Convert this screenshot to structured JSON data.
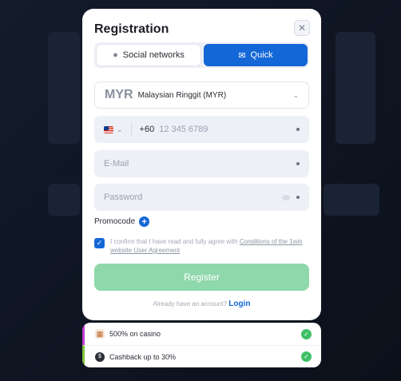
{
  "modal": {
    "title": "Registration",
    "close_icon": "close-icon"
  },
  "tabs": [
    {
      "label": "Social networks",
      "icon": "social-icon",
      "active": false
    },
    {
      "label": "Quick",
      "icon": "envelope-icon",
      "active": true
    }
  ],
  "currency": {
    "code": "MYR",
    "name": "Malaysian Ringgit (MYR)"
  },
  "phone": {
    "country": "Malaysia",
    "prefix": "+60",
    "placeholder": "12 345 6789"
  },
  "email": {
    "placeholder": "E-Mail"
  },
  "password": {
    "placeholder": "Password"
  },
  "promo": {
    "label": "Promocode"
  },
  "agreement": {
    "checked": true,
    "text": "I confirm that I have read and fully agree with",
    "link": "Conditions of the 1win website User Agreement"
  },
  "register_button": {
    "label": "Register"
  },
  "login": {
    "prompt": "Already have an account?",
    "link": "Login"
  },
  "bonuses": [
    {
      "label": "500% on casino",
      "icon": "casino-icon",
      "checked": true,
      "accent": "#c03dd4"
    },
    {
      "label": "Cashback up to 30%",
      "icon": "cashback-icon",
      "checked": true,
      "accent": "#7fc33d"
    }
  ],
  "colors": {
    "primary": "#1467d6",
    "register": "#8fd8ab",
    "check": "#3fbf67"
  }
}
